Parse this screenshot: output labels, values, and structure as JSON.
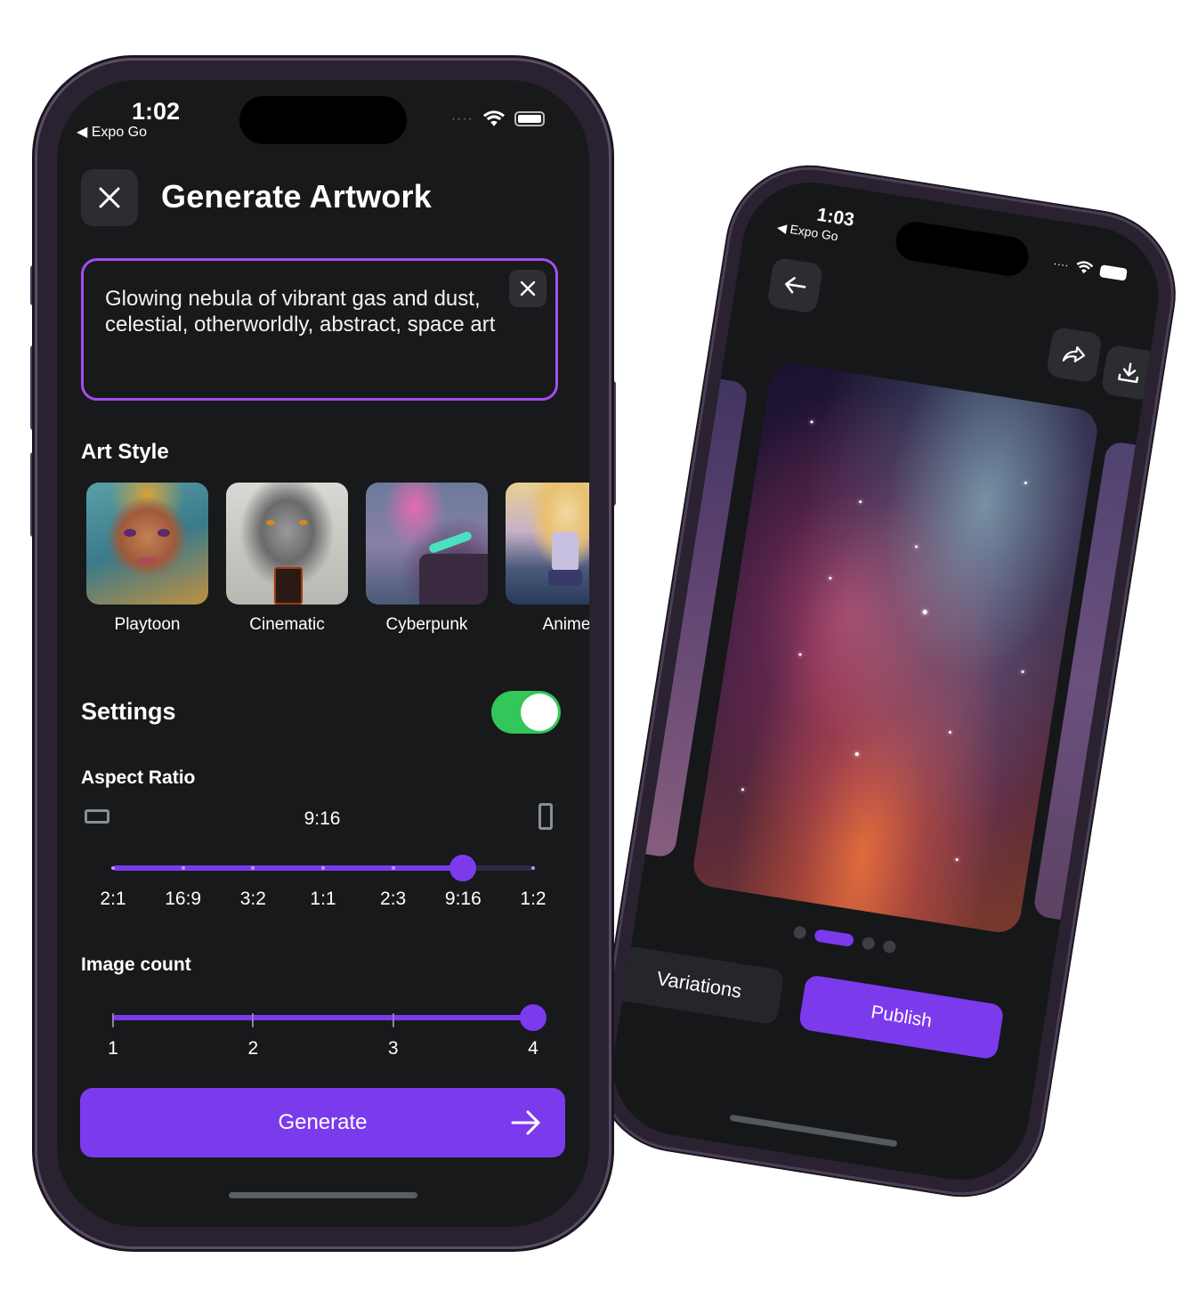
{
  "phone_back": {
    "status": {
      "time": "1:03",
      "back_label": "◀ Expo Go"
    },
    "carousel": {
      "count": 4,
      "active_index": 1
    },
    "actions": {
      "variations_label": "Variations",
      "publish_label": "Publish"
    },
    "icons": {
      "back": "arrow-left-icon",
      "share": "share-icon",
      "download": "download-icon"
    }
  },
  "phone_front": {
    "status": {
      "time": "1:02",
      "back_label": "◀ Expo Go"
    },
    "header": {
      "title": "Generate Artwork"
    },
    "prompt": {
      "text": "Glowing nebula of vibrant gas and dust, celestial, otherworldly, abstract, space art"
    },
    "art_style": {
      "title": "Art Style",
      "items": [
        {
          "label": "Playtoon"
        },
        {
          "label": "Cinematic"
        },
        {
          "label": "Cyberpunk"
        },
        {
          "label": "Anime"
        }
      ]
    },
    "settings": {
      "title": "Settings",
      "enabled": true
    },
    "aspect_ratio": {
      "title": "Aspect Ratio",
      "value": "9:16",
      "options": [
        "2:1",
        "16:9",
        "3:2",
        "1:1",
        "2:3",
        "9:16",
        "1:2"
      ],
      "selected_index": 5
    },
    "image_count": {
      "title": "Image count",
      "options": [
        "1",
        "2",
        "3",
        "4"
      ],
      "selected_index": 3
    },
    "generate": {
      "label": "Generate"
    },
    "colors": {
      "accent": "#7c3aed",
      "prompt_border": "#a64df0",
      "toggle_on": "#33c659",
      "background": "#17191b"
    }
  }
}
